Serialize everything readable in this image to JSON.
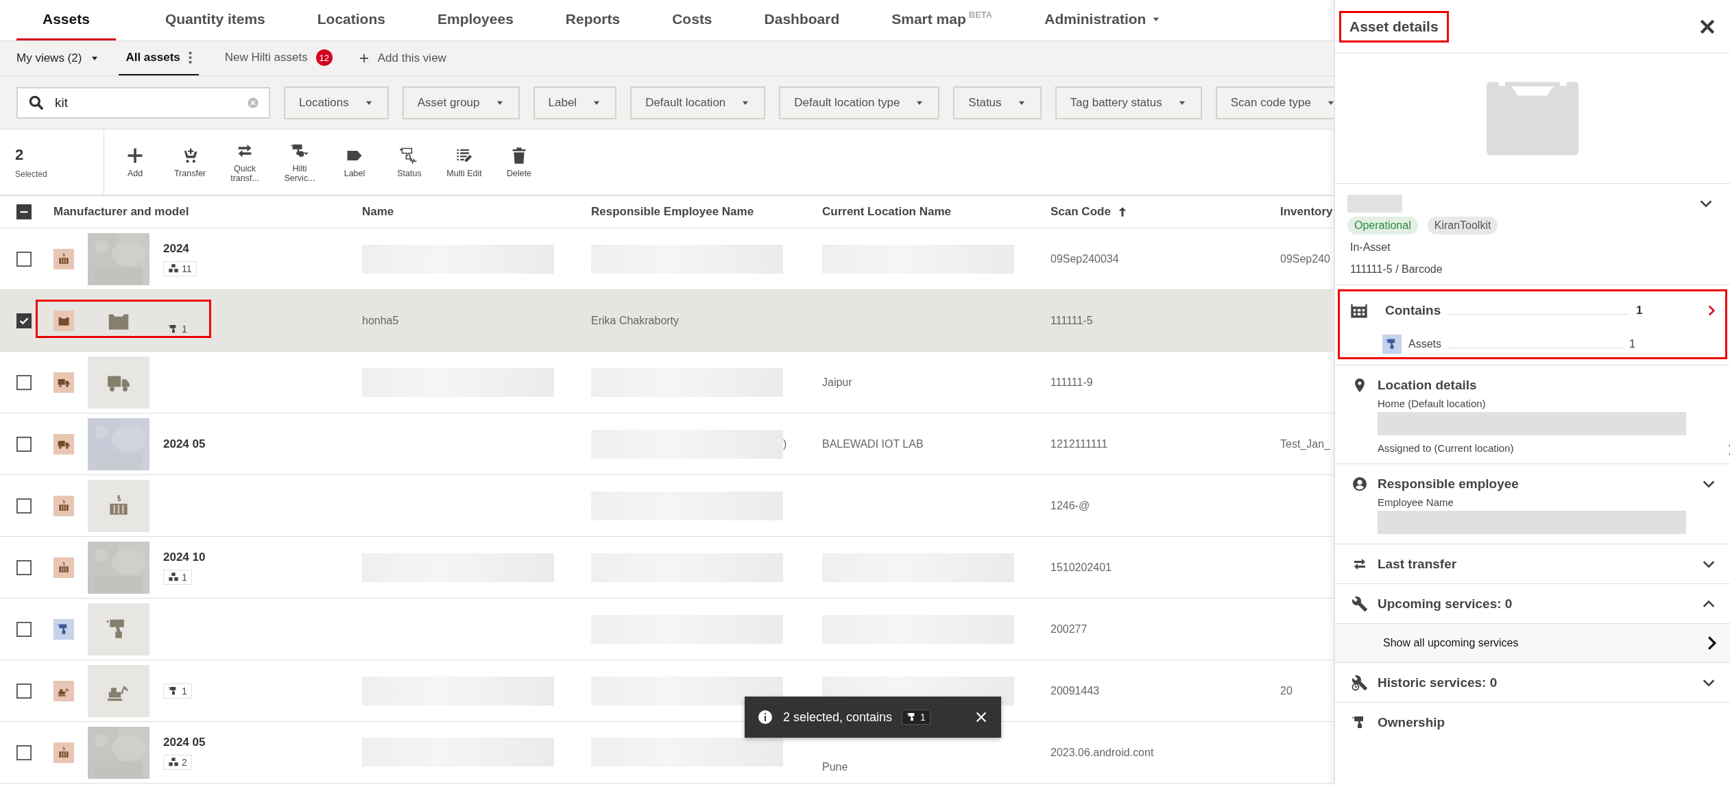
{
  "nav": {
    "tabs": [
      {
        "label": "Assets",
        "selected": true
      },
      {
        "label": "Quantity items",
        "selected": false
      },
      {
        "label": "Locations",
        "selected": false
      },
      {
        "label": "Employees",
        "selected": false
      },
      {
        "label": "Reports",
        "selected": false
      },
      {
        "label": "Costs",
        "selected": false
      },
      {
        "label": "Dashboard",
        "selected": false
      },
      {
        "label": "Smart map",
        "badge": "BETA",
        "selected": false
      },
      {
        "label": "Administration",
        "has_menu": true,
        "selected": false
      }
    ]
  },
  "views": {
    "my_views": "My views (2)",
    "tabs": [
      {
        "label": "All assets",
        "selected": true,
        "has_menu": true
      },
      {
        "label": "New Hilti assets",
        "count": "12",
        "selected": false
      }
    ],
    "add_view": "Add this view"
  },
  "filters": {
    "search": {
      "value": "kit"
    },
    "dropdowns": [
      "Locations",
      "Asset group",
      "Label",
      "Default location",
      "Default location type",
      "Status",
      "Tag battery status",
      "Scan code type"
    ]
  },
  "toolbar": {
    "count": "2",
    "count_label": "Selected",
    "actions": [
      {
        "kind": "plus",
        "label": "Add"
      },
      {
        "kind": "cart",
        "label": "Transfer"
      },
      {
        "kind": "transfer",
        "label": "Quick transf..."
      },
      {
        "kind": "drill-info",
        "label": "Hilti Servic..."
      },
      {
        "kind": "tag",
        "label": "Label"
      },
      {
        "kind": "drill-status",
        "label": "Status"
      },
      {
        "kind": "list-edit",
        "label": "Multi Edit"
      },
      {
        "kind": "trash",
        "label": "Delete"
      }
    ]
  },
  "table": {
    "select_all": {
      "checked": true,
      "partial": true
    },
    "columns": [
      {
        "label": "Manufacturer and model",
        "sorted": false
      },
      {
        "label": "Name",
        "sorted": false
      },
      {
        "label": "Responsible Employee Name",
        "sorted": false
      },
      {
        "label": "Current Location Name",
        "sorted": false
      },
      {
        "label": "Scan Code",
        "sorted": true
      },
      {
        "label": "Inventory",
        "sorted": false
      }
    ],
    "rows": [
      {
        "checked": false,
        "selected": false,
        "highlighted": false,
        "kind": "crate",
        "model": "2024",
        "badge": {
          "kind": "group",
          "count": "11"
        },
        "name": {
          "blurred": true
        },
        "employee": {
          "blurred": true
        },
        "location": {
          "blurred": true
        },
        "scan": "09Sep240034",
        "inventory": "09Sep240"
      },
      {
        "checked": true,
        "selected": true,
        "highlighted": true,
        "kind": "case",
        "thumbnail": {
          "kind": "case"
        },
        "badge": {
          "kind": "tool",
          "count": "1"
        },
        "name": {
          "text": "honha5",
          "blurred": false
        },
        "employee": {
          "text": "Erika Chakraborty",
          "blurred": false
        },
        "scan": "111111-5"
      },
      {
        "checked": false,
        "selected": false,
        "highlighted": false,
        "kind": "truck",
        "thumbnail": {
          "kind": "truck"
        },
        "name": {
          "blurred": true
        },
        "employee": {
          "blurred": true
        },
        "location": {
          "text": "Jaipur",
          "blurred": false
        },
        "scan": "111111-9"
      },
      {
        "checked": false,
        "selected": false,
        "highlighted": false,
        "kind": "truck",
        "model": "2024 05",
        "employee": {
          "text": ")",
          "blurred": true
        },
        "location": {
          "text": "BALEWADI IOT LAB",
          "blurred": false
        },
        "scan": "1212111111",
        "inventory": "Test_Jan_"
      },
      {
        "checked": false,
        "selected": false,
        "highlighted": false,
        "kind": "crate",
        "thumbnail": {
          "kind": "crate"
        },
        "employee": {
          "blurred": true
        },
        "scan": "1246-@"
      },
      {
        "checked": false,
        "selected": false,
        "highlighted": false,
        "kind": "crate",
        "model": "2024 10",
        "badge": {
          "kind": "group",
          "count": "1"
        },
        "name": {
          "blurred": true
        },
        "employee": {
          "blurred": true
        },
        "location": {
          "blurred": true
        },
        "scan": "1510202401"
      },
      {
        "checked": false,
        "selected": false,
        "highlighted": false,
        "kind": "drill",
        "thumbnail": {
          "kind": "drill"
        },
        "employee": {
          "blurred": true
        },
        "location": {
          "blurred": true
        },
        "scan": "200277"
      },
      {
        "checked": false,
        "selected": false,
        "highlighted": false,
        "kind": "excavator",
        "thumbnail": {
          "kind": "excavator"
        },
        "badge": {
          "kind": "tool",
          "count": "1"
        },
        "name": {
          "blurred": true
        },
        "employee": {
          "blurred": true
        },
        "location": {
          "blurred": true
        },
        "scan": "20091443",
        "inventory": "20"
      },
      {
        "checked": false,
        "selected": false,
        "highlighted": false,
        "kind": "crate",
        "model": "2024 05",
        "badge": {
          "kind": "group",
          "count": "2"
        },
        "name": {
          "blurred": true
        },
        "employee": {
          "blurred": true
        },
        "location": {
          "text": "Pune",
          "blurred": false
        },
        "scan": "2023.06.android.cont"
      }
    ]
  },
  "toast": {
    "text": "2 selected, contains",
    "count": "1"
  },
  "panel": {
    "title": "Asset details",
    "highlighted": true,
    "summary": {
      "expanded": false,
      "tags": [
        {
          "label": "Operational",
          "color": "#2a8a3a"
        },
        {
          "label": "KiranToolkit",
          "color": "#555555"
        }
      ],
      "type": "In-Asset",
      "code": "111111-5 / Barcode"
    },
    "contains": {
      "label": "Contains",
      "count": "1",
      "highlighted": true,
      "items": [
        {
          "label": "Assets",
          "count": "1"
        }
      ]
    },
    "sections": [
      {
        "kind": "location",
        "title": "Location details",
        "fields": [
          {
            "label": "Home (Default location)",
            "blurred": true,
            "link": false
          },
          {
            "label": "Assigned to (Current location)",
            "blurred": false,
            "link": true
          }
        ]
      },
      {
        "kind": "person",
        "title": "Responsible employee",
        "expanded": false,
        "fields": [
          {
            "label": "Employee Name",
            "blurred": true,
            "link": false
          }
        ]
      },
      {
        "kind": "transfer",
        "title": "Last transfer",
        "expanded": false
      },
      {
        "kind": "wrench",
        "title": "Upcoming services: 0",
        "expanded": true,
        "link": "Show all upcoming services"
      },
      {
        "kind": "historic",
        "title": "Historic services: 0",
        "expanded": false
      },
      {
        "kind": "drill",
        "title": "Ownership"
      }
    ]
  }
}
